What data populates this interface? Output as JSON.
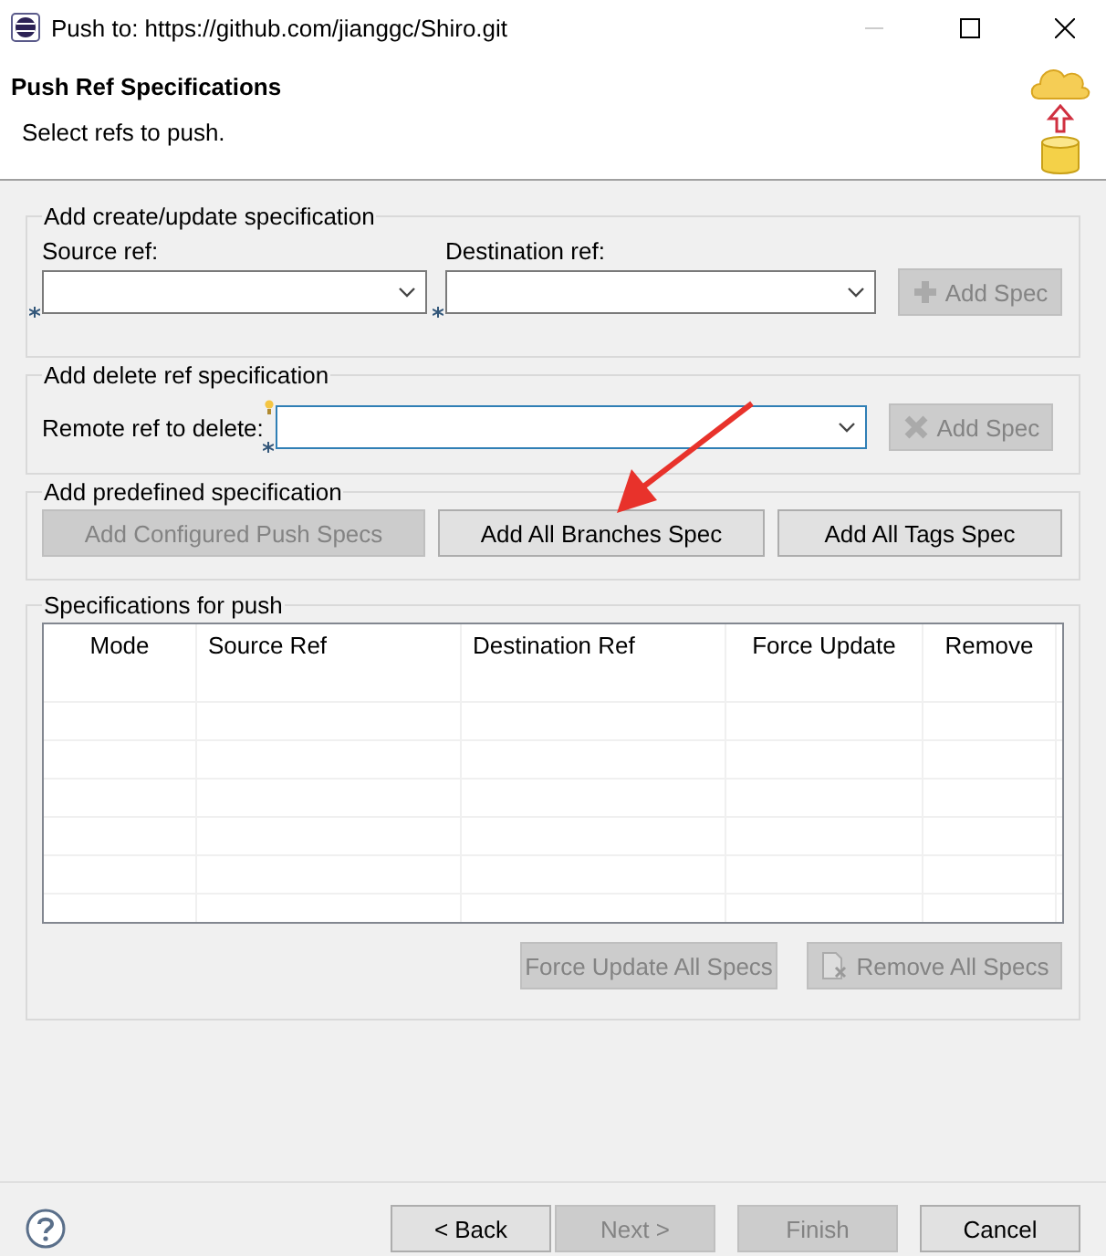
{
  "window": {
    "title": "Push to: https://github.com/jianggc/Shiro.git"
  },
  "header": {
    "title": "Push Ref Specifications",
    "description": "Select refs to push."
  },
  "create_group": {
    "title": "Add create/update specification",
    "source": {
      "label": "Source ref:",
      "required": true,
      "focused": false
    },
    "destination": {
      "label": "Destination ref:",
      "required": true,
      "focused": false
    },
    "add_button": {
      "label": "Add Spec",
      "disabled": true
    }
  },
  "delete_group": {
    "title": "Add delete ref specification",
    "remote": {
      "label": "Remote ref to delete:",
      "required": true,
      "focused": true
    },
    "add_button": {
      "label": "Add Spec",
      "disabled": true
    }
  },
  "predefined_group": {
    "title": "Add predefined specification",
    "buttons": [
      {
        "label": "Add Configured Push Specs",
        "disabled": true
      },
      {
        "label": "Add All Branches Spec",
        "disabled": false
      },
      {
        "label": "Add All Tags Spec",
        "disabled": false
      }
    ]
  },
  "specs_group": {
    "title": "Specifications for push",
    "table": {
      "columns": [
        "Mode",
        "Source Ref",
        "Destination Ref",
        "Force Update",
        "Remove"
      ]
    },
    "buttons": [
      {
        "label": "Force Update All Specs",
        "disabled": true
      },
      {
        "label": "Remove All Specs",
        "disabled": true
      }
    ]
  },
  "footer": {
    "buttons": [
      {
        "label": "< Back",
        "disabled": false
      },
      {
        "label": "Next >",
        "disabled": true
      },
      {
        "label": "Finish",
        "disabled": true
      },
      {
        "label": "Cancel",
        "disabled": false
      }
    ]
  }
}
